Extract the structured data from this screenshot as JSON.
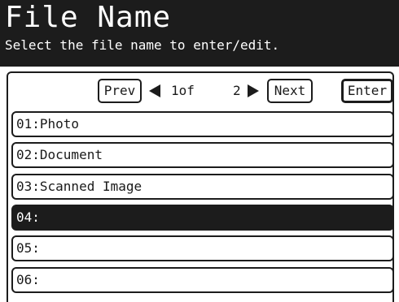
{
  "header": {
    "title": "File Name",
    "subtitle": "Select the file name to enter/edit."
  },
  "nav": {
    "prev_label": "Prev",
    "page_current": "1of",
    "page_total": "2",
    "next_label": "Next",
    "enter_label": "Enter"
  },
  "files": [
    {
      "label": "01:Photo",
      "selected": false
    },
    {
      "label": "02:Document",
      "selected": false
    },
    {
      "label": "03:Scanned Image",
      "selected": false
    },
    {
      "label": "04:",
      "selected": true
    },
    {
      "label": "05:",
      "selected": false
    },
    {
      "label": "06:",
      "selected": false
    }
  ],
  "icons": {
    "page_prev": "triangle-left-icon",
    "page_next": "triangle-right-icon"
  },
  "colors": {
    "header_bg": "#1c1c1c",
    "selected_bg": "#1c1c1c",
    "background": "#ffffff"
  }
}
